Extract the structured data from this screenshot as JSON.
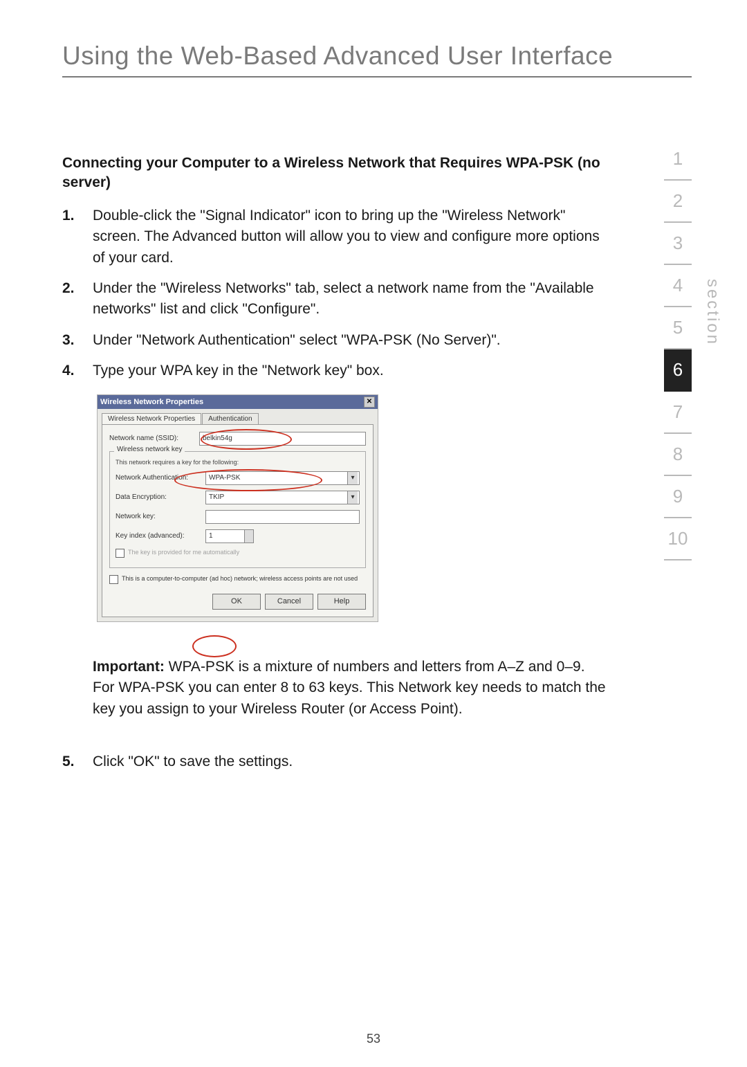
{
  "header": "Using the Web-Based Advanced User Interface",
  "subhead": "Connecting your Computer to a Wireless Network that Requires WPA-PSK (no server)",
  "steps": [
    {
      "n": "1.",
      "t": "Double-click the \"Signal Indicator\" icon to bring up the \"Wireless Network\" screen. The Advanced button will allow you to view and configure more options of your card."
    },
    {
      "n": "2.",
      "t": "Under the \"Wireless Networks\" tab, select a network name from the \"Available networks\" list and click \"Configure\"."
    },
    {
      "n": "3.",
      "t": "Under \"Network Authentication\" select \"WPA-PSK (No Server)\"."
    },
    {
      "n": "4.",
      "t": "Type your WPA key in the \"Network key\" box."
    }
  ],
  "important_label": "Important:",
  "important_text": " WPA-PSK is a mixture of numbers and letters from A–Z and 0–9. For WPA-PSK you can enter 8 to 63 keys. This Network key needs to match the key you assign to your Wireless Router (or Access Point).",
  "step5_n": "5.",
  "step5_t": "Click \"OK\" to save the settings.",
  "page_number": "53",
  "section_label": "section",
  "sections": [
    "1",
    "2",
    "3",
    "4",
    "5",
    "6",
    "7",
    "8",
    "9",
    "10"
  ],
  "active_section": "6",
  "dialog": {
    "title": "Wireless Network Properties",
    "close": "✕",
    "tab1": "Wireless Network Properties",
    "tab2": "Authentication",
    "ssid_label": "Network name (SSID):",
    "ssid_value": "belkin54g",
    "group_legend": "Wireless network key",
    "group_note": "This network requires a key for the following:",
    "auth_label": "Network Authentication:",
    "auth_value": "WPA-PSK",
    "enc_label": "Data Encryption:",
    "enc_value": "TKIP",
    "key_label": "Network key:",
    "idx_label": "Key index (advanced):",
    "idx_value": "1",
    "cb_auto": "The key is provided for me automatically",
    "cb_adhoc": "This is a computer-to-computer (ad hoc) network; wireless access points are not used",
    "ok": "OK",
    "cancel": "Cancel",
    "help": "Help"
  }
}
